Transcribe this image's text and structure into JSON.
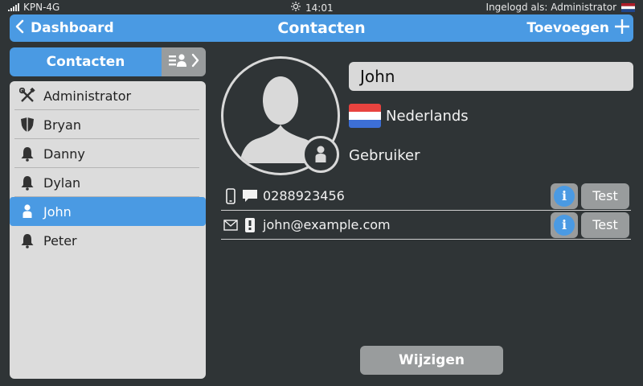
{
  "status": {
    "carrier": "KPN-4G",
    "time": "14:01",
    "login_text": "Ingelogd als: Administrator"
  },
  "header": {
    "back_label": "Dashboard",
    "title": "Contacten",
    "add_label": "Toevoegen"
  },
  "sidebar": {
    "tab_label": "Contacten",
    "items": [
      {
        "label": "Administrator",
        "icon": "tools-icon"
      },
      {
        "label": "Bryan",
        "icon": "shield-icon"
      },
      {
        "label": "Danny",
        "icon": "bell-icon"
      },
      {
        "label": "Dylan",
        "icon": "bell-icon"
      },
      {
        "label": "John",
        "icon": "person-icon",
        "selected": true
      },
      {
        "label": "Peter",
        "icon": "bell-icon"
      }
    ]
  },
  "detail": {
    "name": "John",
    "language": "Nederlands",
    "role": "Gebruiker",
    "contacts": [
      {
        "value": "0288923456",
        "info_label": "i",
        "test_label": "Test"
      },
      {
        "value": "john@example.com",
        "info_label": "i",
        "test_label": "Test"
      }
    ],
    "edit_label": "Wijzigen"
  },
  "colors": {
    "accent": "#4a9ae3",
    "background": "#2f3436",
    "panel": "#dcdcdc",
    "button_gray": "#999c9d"
  }
}
